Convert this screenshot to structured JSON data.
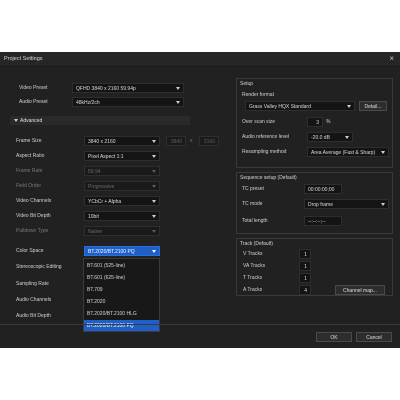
{
  "window": {
    "title": "Project Settings",
    "close": "×"
  },
  "video_preset": {
    "label": "Video Preset",
    "value": "QFHD 3840 x 2160 59.94p"
  },
  "audio_preset": {
    "label": "Audio Preset",
    "value": "48kHz/2ch"
  },
  "advanced": {
    "label": "Advanced"
  },
  "frame_size": {
    "label": "Frame Size",
    "value": "3840 x 2160",
    "width": "3840",
    "x": "x",
    "height": "2160"
  },
  "aspect_ratio": {
    "label": "Aspect Ratio",
    "value": "Pixel Aspect 1:1"
  },
  "frame_rate": {
    "label": "Frame Rate",
    "value": "59.94"
  },
  "field_order": {
    "label": "Field Order",
    "value": "Progressive"
  },
  "video_channels": {
    "label": "Video Channels",
    "value": "YCbCr + Alpha"
  },
  "video_bit_depth": {
    "label": "Video Bit Depth",
    "value": "10bit"
  },
  "pulldown_type": {
    "label": "Pulldown Type",
    "value": "Native"
  },
  "color_space": {
    "label": "Color Space",
    "value": "BT.2020/BT.2100 PQ",
    "options": [
      "BT.601 (525-line)",
      "BT.601 (625-line)",
      "BT.709",
      "BT.2020",
      "BT.2020/BT.2100 HLG",
      "BT.2020/BT.2100 PQ"
    ],
    "highlighted": "BT.2020/BT.2100 PQ"
  },
  "stereoscopic_editing": {
    "label": "Stereoscopic Editing"
  },
  "sampling_rate": {
    "label": "Sampling Rate"
  },
  "audio_channels": {
    "label": "Audio Channels"
  },
  "audio_bit_depth": {
    "label": "Audio Bit Depth"
  },
  "setup": {
    "title": "Setup",
    "render_format_label": "Render format",
    "render_format_value": "Grass Valley HQX Standard",
    "detail_button": "Detail...",
    "over_scan_label": "Over scan size",
    "over_scan_value": "3",
    "over_scan_unit": "%",
    "audio_ref_label": "Audio reference level",
    "audio_ref_value": "-20.0 dB",
    "resampling_label": "Resampling method",
    "resampling_value": "Area Average (Fast & Sharp)"
  },
  "sequence": {
    "title": "Sequence setup (Default)",
    "tc_preset_label": "TC preset",
    "tc_preset_value": "00:00:00;00",
    "tc_mode_label": "TC mode",
    "tc_mode_value": "Drop frame",
    "total_length_label": "Total length",
    "total_length_value": "--:--:--;--"
  },
  "track": {
    "title": "Track (Default)",
    "v_label": "V Tracks",
    "v_value": "1",
    "va_label": "VA Tracks",
    "va_value": "1",
    "t_label": "T Tracks",
    "t_value": "1",
    "a_label": "A Tracks",
    "a_value": "4",
    "channel_map_button": "Channel map..."
  },
  "footer": {
    "ok": "OK",
    "cancel": "Cancel"
  },
  "colors": {
    "dialog_bg": "#212121",
    "accent": "#1e60c8"
  }
}
